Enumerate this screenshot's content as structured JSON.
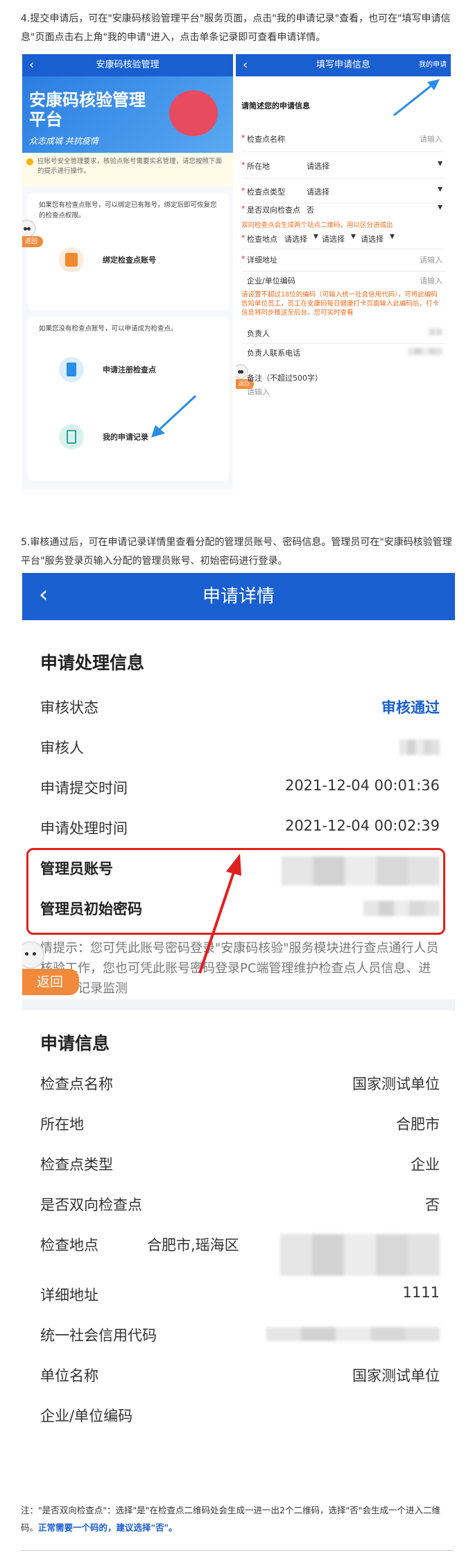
{
  "step4": {
    "text": "4.提交申请后，可在\"安康码核验管理平台\"服务页面，点击\"我的申请记录\"查看，也可在\"填写申请信息\"页面点击右上角\"我的申请\"进入，点击单条记录即可查看申请详情。"
  },
  "left_phone": {
    "title": "安康码核验管理",
    "banner_title": "安康码核验管理平台",
    "banner_slogan": "众志成城 共抗疫情",
    "notice": "应账号安全管理要求，核验点账号需要实名管理，请您按照下面的提示进行操作。",
    "card1_text": "如果您有检查点账号，可以绑定已有账号，绑定后即可恢复您的检查点权限。",
    "back_tab": "返回",
    "bind_label": "绑定检查点账号",
    "card2_text": "如果您没有检查点账号，可以申请成为检查点。",
    "register_label": "申请注册检查点",
    "records_label": "我的申请记录"
  },
  "right_phone": {
    "title": "填写申请信息",
    "my_apply": "我的申请",
    "section_title": "请简述您的申请信息",
    "name_label": "检查点名称",
    "input_hint": "请输入",
    "location_label": "所在地",
    "select_hint": "请选择",
    "type_label": "检查点类型",
    "bidir_label": "是否双向检查点",
    "bidir_value": "否",
    "bidir_note": "双向检查点会生成两个站点二维码，用以区分进或出",
    "place_label": "检查地点",
    "address_label": "详细地址",
    "code_label": "企业/单位编码",
    "code_note": "请设置不超过18位的编码（可输入统一社会信用代码），可将此编码告知单位员工，员工在安康码每日健康打卡页面输入此编码后，打卡信息将同步推送至后台，您可实时查看",
    "owner_label": "负责人",
    "phone_label": "负责人联系电话",
    "remark_label": "备注（不超过500字）",
    "remark_hint": "请输入",
    "back_tab": "返回"
  },
  "step5": {
    "text": "5.审核通过后，可在申请记录详情里查看分配的管理员账号、密码信息。管理员可在\"安康码核验管理平台\"服务登录页输入分配的管理员账号、初始密码进行登录。"
  },
  "detail": {
    "title": "申请详情",
    "process_section": "申请处理信息",
    "status_label": "审核状态",
    "status_value": "审核通过",
    "reviewer_label": "审核人",
    "submit_label": "申请提交时间",
    "submit_value": "2021-12-04 00:01:36",
    "handle_label": "申请处理时间",
    "handle_value": "2021-12-04 00:02:39",
    "account_label": "管理员账号",
    "password_label": "管理员初始密码",
    "tip_text": "情提示：您可凭此账号密码登录\"安康码核验\"服务模块进行查点通行人员核验工作，您也可凭此账号密码登录PC端管理维护检查点人员信息、进行日常记录监测",
    "back_tab": "返回",
    "apply_section": "申请信息",
    "rows": [
      {
        "label": "检查点名称",
        "value": "国家测试单位"
      },
      {
        "label": "所在地",
        "value": "合肥市"
      },
      {
        "label": "检查点类型",
        "value": "企业"
      },
      {
        "label": "是否双向检查点",
        "value": "否"
      },
      {
        "label": "检查地点",
        "value": "合肥市,瑶海区"
      },
      {
        "label": "详细地址",
        "value": "1111"
      },
      {
        "label": "统一社会信用代码",
        "value": ""
      },
      {
        "label": "单位名称",
        "value": "国家测试单位"
      },
      {
        "label": "企业/单位编码",
        "value": ""
      }
    ]
  },
  "note": {
    "text": "注：\"是否双向检查点\"：选择\"是\"在检查点二维码处会生成一进一出2个二维码，选择\"否\"会生成一个进入二维码。",
    "emphasis": "正常需要一个码的，建议选择\"否\"。"
  },
  "colors": {
    "accent": "#1a5fd0",
    "highlight": "#e02020",
    "tab": "#f28a3c"
  }
}
